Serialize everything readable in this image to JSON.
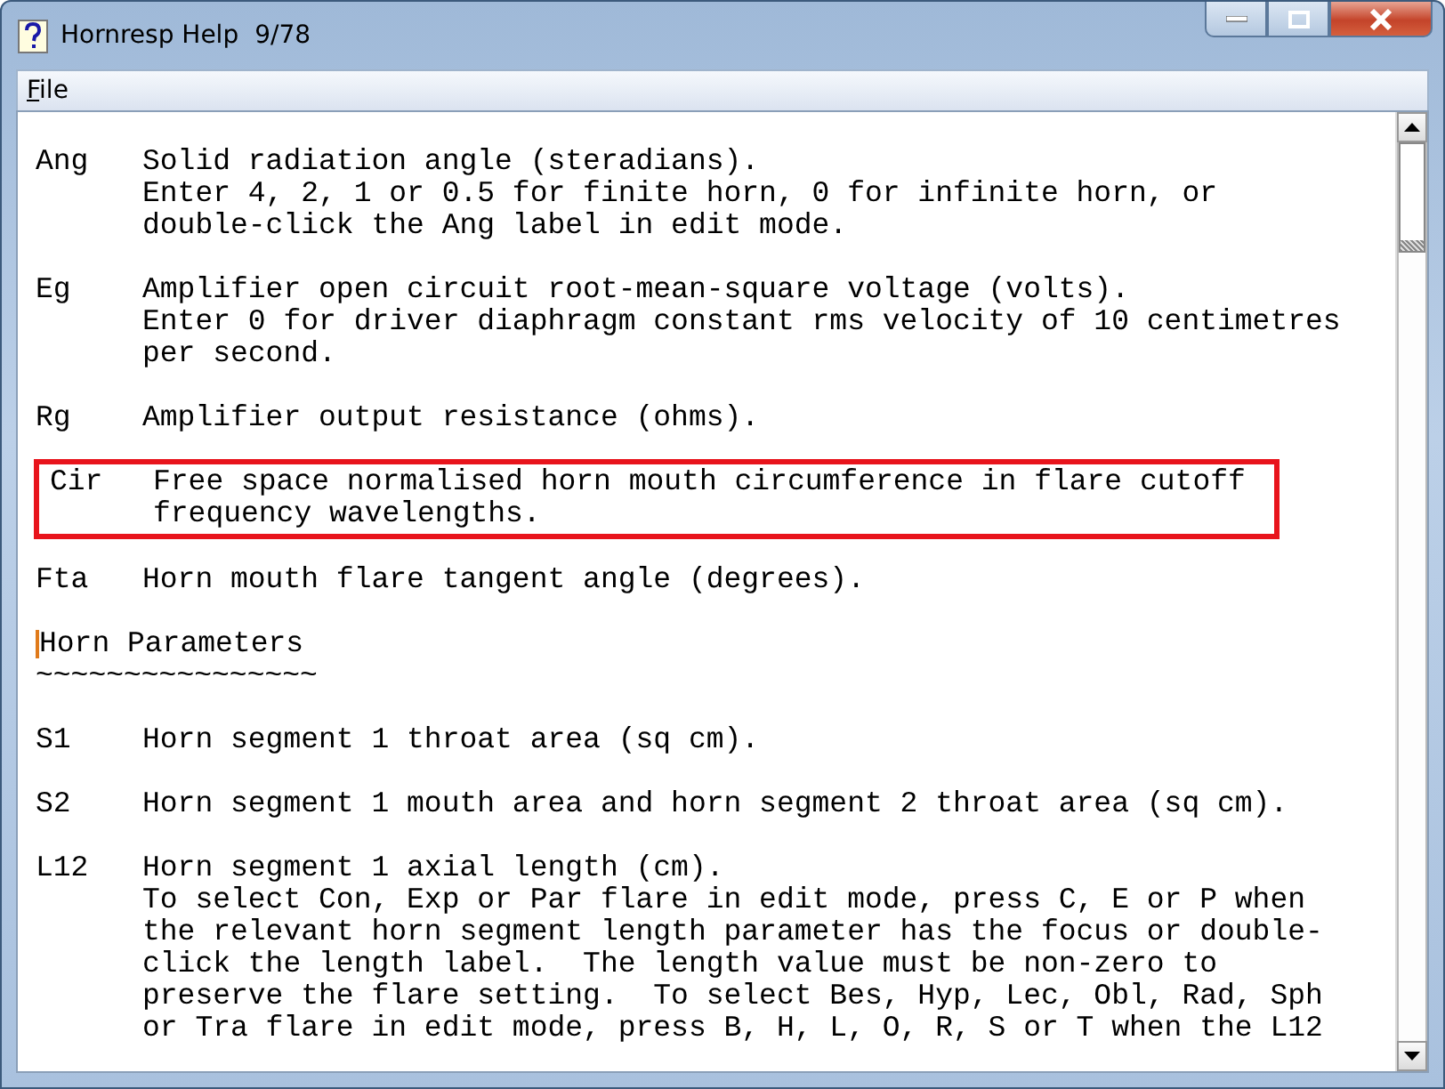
{
  "window": {
    "title": "Hornresp Help",
    "page": "9/78"
  },
  "menu": [
    {
      "label": "File"
    }
  ],
  "blocks": [
    {
      "kind": "entry",
      "label": "Ang",
      "highlighted": false,
      "lines": [
        "Solid radiation angle (steradians).",
        "Enter 4, 2, 1 or 0.5 for finite horn, 0 for infinite horn, or",
        "double-click the Ang label in edit mode."
      ]
    },
    {
      "kind": "entry",
      "label": "Eg",
      "highlighted": false,
      "lines": [
        "Amplifier open circuit root-mean-square voltage (volts).",
        "Enter 0 for driver diaphragm constant rms velocity of 10 centimetres",
        "per second."
      ]
    },
    {
      "kind": "entry",
      "label": "Rg",
      "highlighted": false,
      "lines": [
        "Amplifier output resistance (ohms)."
      ]
    },
    {
      "kind": "entry",
      "label": "Cir",
      "highlighted": true,
      "lines": [
        "Free space normalised horn mouth circumference in flare cutoff",
        "frequency wavelengths."
      ]
    },
    {
      "kind": "entry",
      "label": "Fta",
      "highlighted": false,
      "lines": [
        "Horn mouth flare tangent angle (degrees)."
      ]
    },
    {
      "kind": "heading",
      "cursor": true,
      "text": "Horn Parameters",
      "underline": "~~~~~~~~~~~~~~~~"
    },
    {
      "kind": "entry",
      "label": "S1",
      "highlighted": false,
      "lines": [
        "Horn segment 1 throat area (sq cm)."
      ]
    },
    {
      "kind": "entry",
      "label": "S2",
      "highlighted": false,
      "lines": [
        "Horn segment 1 mouth area and horn segment 2 throat area (sq cm)."
      ]
    },
    {
      "kind": "entry",
      "label": "L12",
      "highlighted": false,
      "lines": [
        "Horn segment 1 axial length (cm).",
        "To select Con, Exp or Par flare in edit mode, press C, E or P when",
        "the relevant horn segment length parameter has the focus or double-",
        "click the length label.  The length value must be non-zero to",
        "preserve the flare setting.  To select Bes, Hyp, Lec, Obl, Rad, Sph",
        "or Tra flare in edit mode, press B, H, L, O, R, S or T when the L12"
      ]
    }
  ]
}
